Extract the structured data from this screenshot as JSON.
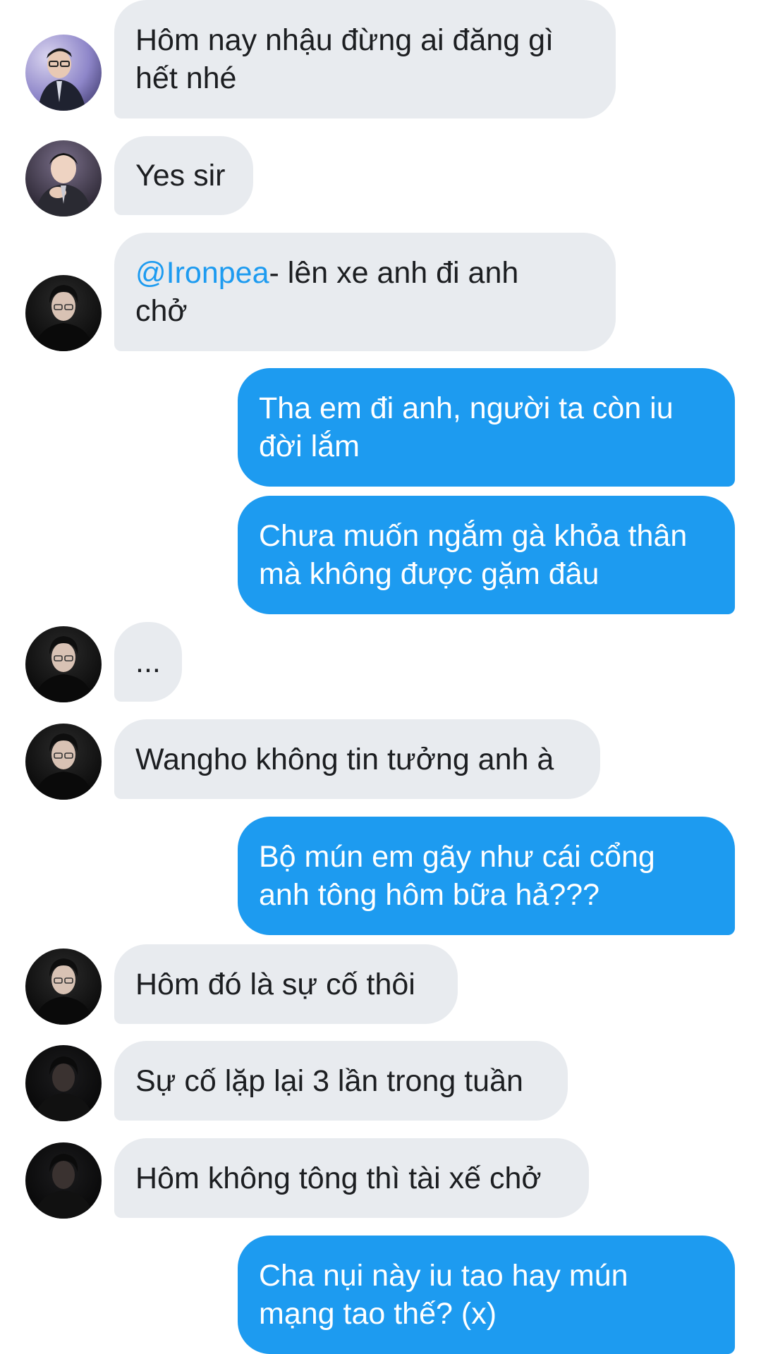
{
  "colors": {
    "incoming_bubble": "#e8ebef",
    "outgoing_bubble": "#1d9bf0",
    "mention": "#1d9bf0"
  },
  "messages": [
    {
      "direction": "incoming",
      "avatar": "avatar-suit-glasses",
      "text": "Hôm nay nhậu đừng ai đăng gì\nhết nhé"
    },
    {
      "direction": "incoming",
      "avatar": "avatar-suit-hand",
      "text": "Yes sir"
    },
    {
      "direction": "incoming",
      "avatar": "avatar-black-shirt",
      "mention": "@Ironpea",
      "text": "- lên xe anh đi anh\nchở"
    },
    {
      "direction": "outgoing",
      "text": "Tha em đi anh, người ta còn iu\nđời lắm"
    },
    {
      "direction": "outgoing",
      "text": "Chưa muốn ngắm gà khỏa thân\nmà không được gặm đâu"
    },
    {
      "direction": "incoming",
      "avatar": "avatar-black-shirt",
      "text": "..."
    },
    {
      "direction": "incoming",
      "avatar": "avatar-black-shirt",
      "text": "Wangho không tin tưởng anh à"
    },
    {
      "direction": "outgoing",
      "text": "Bộ mún em gãy như cái cổng\nanh tông hôm bữa hả???"
    },
    {
      "direction": "incoming",
      "avatar": "avatar-black-shirt",
      "text": "Hôm đó là sự cố thôi"
    },
    {
      "direction": "incoming",
      "avatar": "avatar-dark",
      "text": "Sự cố lặp lại 3 lần trong tuần"
    },
    {
      "direction": "incoming",
      "avatar": "avatar-dark",
      "text": "Hôm không tông thì tài xế chở"
    },
    {
      "direction": "outgoing",
      "text": "Cha nụi này iu tao hay mún\nmạng tao thế? (x)"
    }
  ]
}
